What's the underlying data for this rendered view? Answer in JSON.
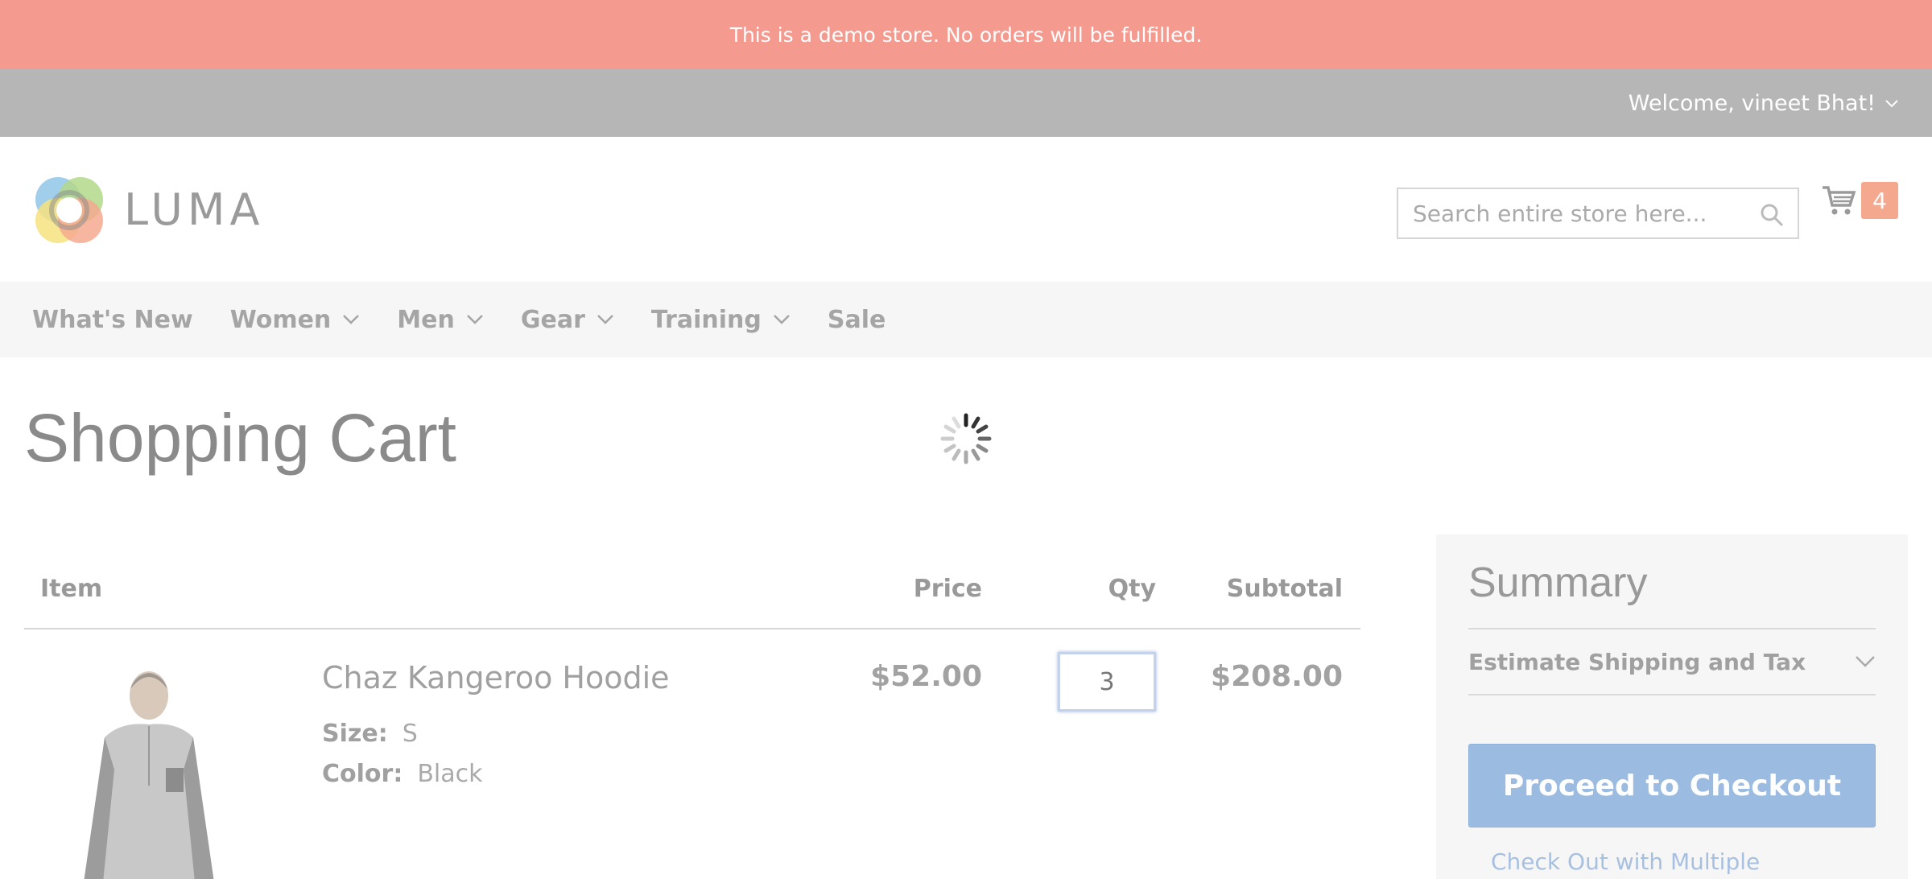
{
  "demo_notice": "This is a demo store. No orders will be fulfilled.",
  "header_panel": {
    "welcome": "Welcome, vineet Bhat!"
  },
  "header": {
    "logo_text": "LUMA",
    "search_placeholder": "Search entire store here...",
    "cart_count": "4"
  },
  "nav": {
    "items": [
      {
        "label": "What's New",
        "dropdown": false
      },
      {
        "label": "Women",
        "dropdown": true
      },
      {
        "label": "Men",
        "dropdown": true
      },
      {
        "label": "Gear",
        "dropdown": true
      },
      {
        "label": "Training",
        "dropdown": true
      },
      {
        "label": "Sale",
        "dropdown": false
      }
    ]
  },
  "page_title": "Shopping Cart",
  "cart_table": {
    "headers": {
      "item": "Item",
      "price": "Price",
      "qty": "Qty",
      "subtotal": "Subtotal"
    },
    "items": [
      {
        "name": "Chaz Kangeroo Hoodie",
        "options": [
          {
            "label": "Size:",
            "value": "S"
          },
          {
            "label": "Color:",
            "value": "Black"
          }
        ],
        "price": "$52.00",
        "qty": "3",
        "subtotal": "$208.00"
      }
    ]
  },
  "summary": {
    "title": "Summary",
    "shipping_label": "Estimate Shipping and Tax",
    "checkout_label": "Proceed to Checkout",
    "multi_address_label": "Check Out with Multiple Addresses"
  },
  "colors": {
    "demo_notice_bg": "#f49a8f",
    "panel_bg": "#b6b6b6",
    "checkout_bg": "#9bbce0",
    "cart_badge": "#f4a98f"
  },
  "icons": {
    "search": "search-icon",
    "cart": "cart-icon",
    "chevron": "chevron-down-icon",
    "loading": "loading-spinner-icon"
  }
}
